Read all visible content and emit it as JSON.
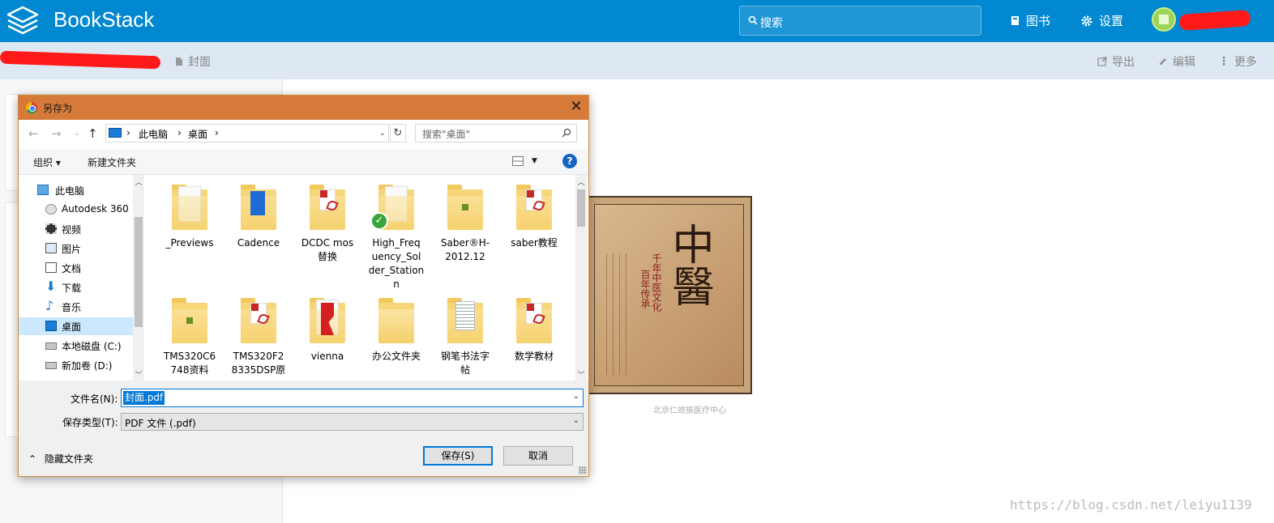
{
  "app": {
    "name": "BookStack",
    "search_placeholder": "搜索",
    "nav_books": "图书",
    "nav_settings": "设置"
  },
  "breadcrumb": {
    "current": "封面"
  },
  "page_actions": {
    "export": "导出",
    "edit": "编辑",
    "more": "更多"
  },
  "dialog": {
    "title": "另存为",
    "address": [
      "此电脑",
      "桌面"
    ],
    "search_placeholder": "搜索\"桌面\"",
    "toolbar": {
      "organize": "组织 ▾",
      "new_folder": "新建文件夹"
    },
    "nav_items": [
      {
        "label": "此电脑",
        "icon": "computer-icon"
      },
      {
        "label": "Autodesk 360",
        "icon": "cloud-icon"
      },
      {
        "label": "视频",
        "icon": "video-icon"
      },
      {
        "label": "图片",
        "icon": "picture-icon"
      },
      {
        "label": "文档",
        "icon": "document-icon"
      },
      {
        "label": "下载",
        "icon": "download-icon"
      },
      {
        "label": "音乐",
        "icon": "music-icon"
      },
      {
        "label": "桌面",
        "icon": "desktop-icon"
      },
      {
        "label": "本地磁盘 (C:)",
        "icon": "drive-icon"
      },
      {
        "label": "新加卷 (D:)",
        "icon": "drive-icon"
      }
    ],
    "files": [
      {
        "lines": [
          "_Previews"
        ]
      },
      {
        "lines": [
          "Cadence"
        ]
      },
      {
        "lines": [
          "DCDC mos",
          "替换"
        ]
      },
      {
        "lines": [
          "High_Freq",
          "uency_Sol",
          "der_Station",
          "n"
        ]
      },
      {
        "lines": [
          "Saber®H-",
          "2012.12"
        ]
      },
      {
        "lines": [
          "saber教程"
        ]
      },
      {
        "lines": [
          "TMS320C6",
          "748资料"
        ]
      },
      {
        "lines": [
          "TMS320F2",
          "8335DSP原"
        ]
      },
      {
        "lines": [
          "vienna"
        ]
      },
      {
        "lines": [
          "办公文件夹"
        ]
      },
      {
        "lines": [
          "钢笔书法字",
          "帖"
        ]
      },
      {
        "lines": [
          "数学教材"
        ]
      }
    ],
    "filename_label": "文件名(N):",
    "filename_value": "封面.pdf",
    "filetype_label": "保存类型(T):",
    "filetype_value": "PDF 文件 (.pdf)",
    "hide_folders": "隐藏文件夹",
    "save_button": "保存(S)",
    "cancel_button": "取消"
  },
  "cover_image": {
    "title": "中醫",
    "subtitle": "千年中医文化",
    "side_text": "百年传承",
    "watermark": "北京仁效振医疗中心"
  },
  "csdn_watermark": "https://blog.csdn.net/leiyu1139",
  "colors": {
    "header": "#0288d1",
    "subbar": "#dde8f3",
    "dialog_title": "#d57a39",
    "accent": "#0078d7"
  }
}
